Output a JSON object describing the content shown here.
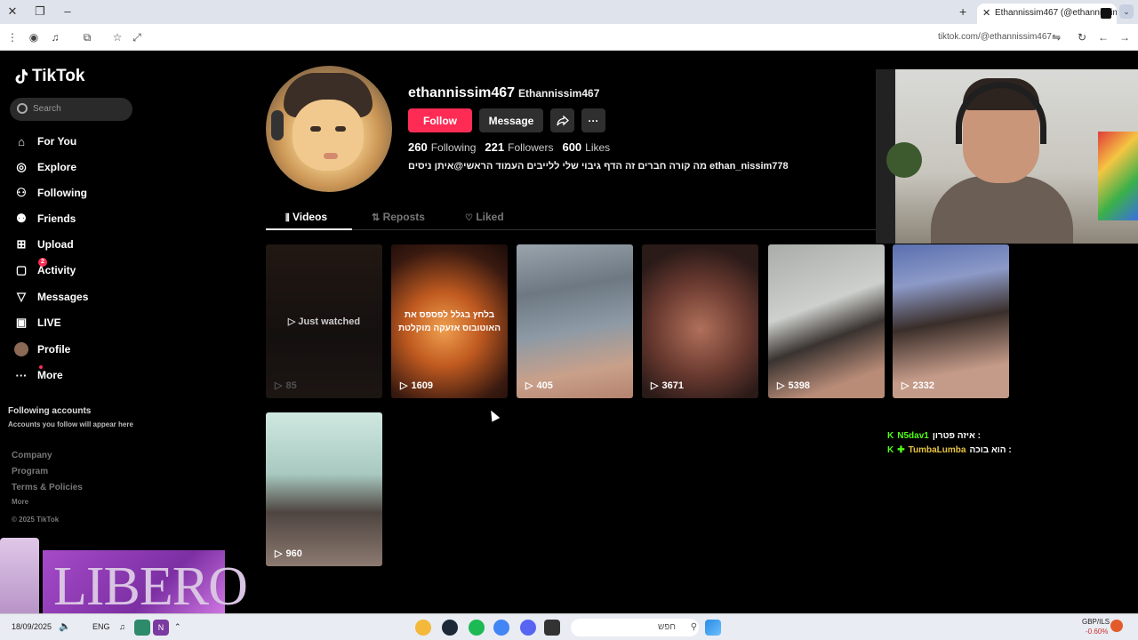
{
  "browser": {
    "tab_title": "Ethannissim467 (@ethannissim",
    "url": "tiktok.com/@ethannissim467"
  },
  "sidebar": {
    "logo": "TikTok",
    "search_placeholder": "Search",
    "items": [
      {
        "label": "For You",
        "icon": "home-icon"
      },
      {
        "label": "Explore",
        "icon": "compass-icon"
      },
      {
        "label": "Following",
        "icon": "following-icon"
      },
      {
        "label": "Friends",
        "icon": "friends-icon"
      },
      {
        "label": "Upload",
        "icon": "upload-icon"
      },
      {
        "label": "Activity",
        "icon": "activity-icon",
        "badge": "2"
      },
      {
        "label": "Messages",
        "icon": "messages-icon"
      },
      {
        "label": "LIVE",
        "icon": "live-icon"
      },
      {
        "label": "Profile",
        "icon": "profile-avatar-icon"
      },
      {
        "label": "More",
        "icon": "more-icon"
      }
    ],
    "following_accounts_title": "Following accounts",
    "following_accounts_sub": "Accounts you follow will appear here",
    "footer": [
      "Company",
      "Program",
      "Terms & Policies",
      "More"
    ],
    "copyright": "© 2025 TikTok"
  },
  "profile": {
    "username": "ethannissim467",
    "nickname": "Ethannissim467",
    "follow_label": "Follow",
    "message_label": "Message",
    "following_count": "260",
    "following_label": "Following",
    "followers_count": "221",
    "followers_label": "Followers",
    "likes_count": "600",
    "likes_label": "Likes",
    "bio": "מה קורה חברים זה הדף גיבוי שלי ללייבים העמוד הראשי@איתן ניסים ethan_nissim778"
  },
  "tabs": {
    "videos": "Videos",
    "reposts": "Reposts",
    "liked": "Liked"
  },
  "videos": [
    {
      "views": "85",
      "overlay": "Just watched"
    },
    {
      "views": "1609",
      "caption_line1": "בלחץ בגלל לפספס את",
      "caption_line2": "האוטובוס אזעקה מוקלטת"
    },
    {
      "views": "405"
    },
    {
      "views": "3671"
    },
    {
      "views": "5398"
    },
    {
      "views": "2332"
    },
    {
      "views": "960"
    }
  ],
  "chat": [
    {
      "user": "N5dav1",
      "message": "איזה פטרון :"
    },
    {
      "user": "TumbaLumba",
      "message": "הוא בוכה :"
    }
  ],
  "ad": {
    "brand": "LIBERO"
  },
  "taskbar": {
    "date": "18/09/2025",
    "language": "ENG",
    "search_placeholder": "חפש",
    "ticker_symbol": "GBP/ILS",
    "ticker_change": "-0.60%"
  },
  "colors": {
    "accent": "#fe2c55",
    "background": "#000000",
    "kick_green": "#53fc18"
  }
}
